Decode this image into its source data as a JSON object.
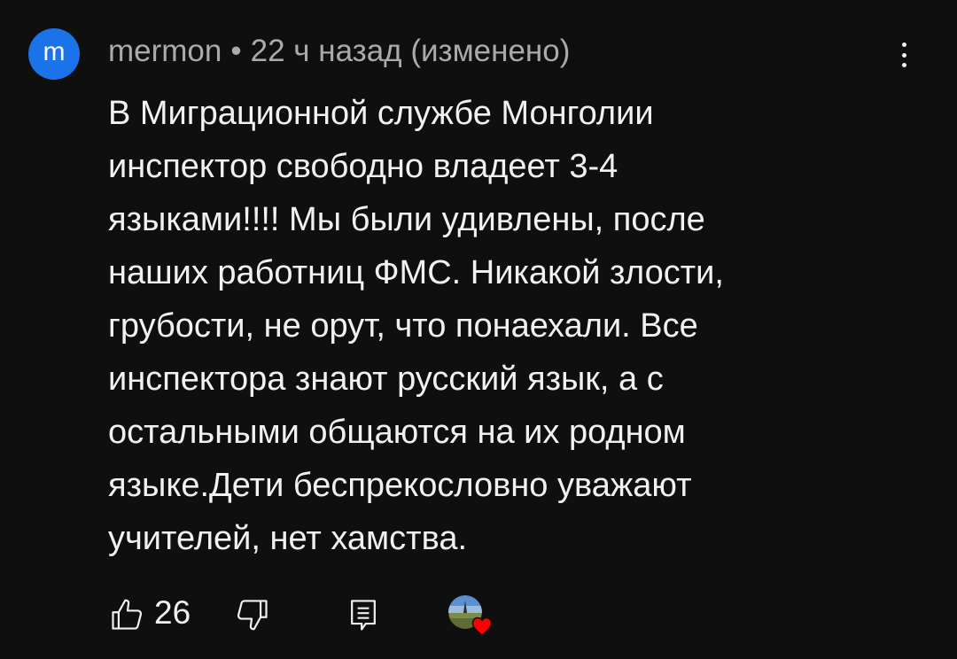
{
  "comment": {
    "avatar_letter": "m",
    "avatar_color": "#1a73e8",
    "author": "mermon",
    "separator": "•",
    "time": "22 ч назад",
    "edited": "(изменено)",
    "text": "В Миграционной службе Монголии\nинспектор свободно владеет 3-4\nязыками!!!! Мы были удивлены, после\nнаших работниц ФМС. Никакой злости,\nгрубости, не орут, что понаехали. Все\nинспектора знают русский язык, а с\nостальными общаются на их родном\nязыке.Дети беспрекословно уважают\nучителей, нет хамства.",
    "like_count": "26",
    "icons": {
      "menu": "more-vert-icon",
      "like": "thumb-up-icon",
      "dislike": "thumb-down-icon",
      "reply": "reply-icon",
      "creator_heart": "heart-icon"
    },
    "heart_color": "#ff0000"
  }
}
